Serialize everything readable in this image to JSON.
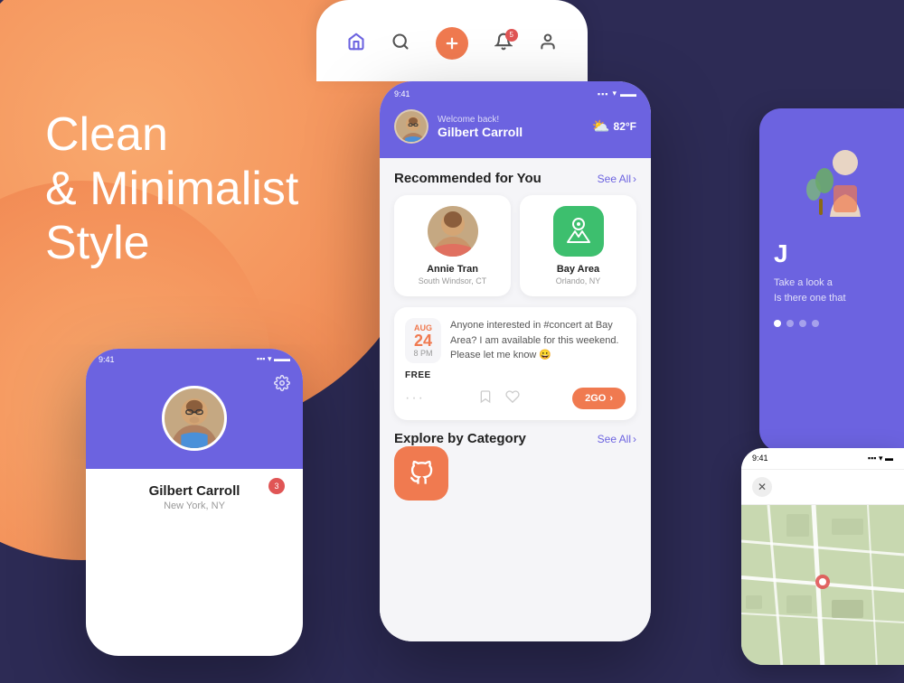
{
  "background": {
    "color": "#2d2b55"
  },
  "hero": {
    "line1": "Clean",
    "line2": "& Minimalist",
    "line3": "Style"
  },
  "phone_profile": {
    "status_time": "9:41",
    "user_name": "Gilbert Carroll",
    "user_location": "New York, NY",
    "badge_count": "3"
  },
  "phone_main": {
    "status_time": "9:41",
    "welcome_sub": "Welcome back!",
    "welcome_name": "Gilbert Carroll",
    "weather_temp": "82°F",
    "recommended_title": "Recommended for You",
    "see_all_1": "See All",
    "person_name": "Annie Tran",
    "person_location": "South Windsor, CT",
    "place_name": "Bay Area",
    "place_location": "Orlando, NY",
    "event_month": "AUG",
    "event_day": "24",
    "event_time": "8 PM",
    "event_desc": "Anyone interested in #concert at Bay Area? I am available for this weekend. Please let me know 😀",
    "event_price": "FREE",
    "event_cta": "2GO",
    "explore_title": "Explore by Category",
    "see_all_2": "See All"
  },
  "phone_top_strip": {
    "nav_home": "🏠",
    "nav_search": "🔍",
    "nav_add": "+",
    "nav_bell": "🔔",
    "nav_user": "👤",
    "badge": "5"
  },
  "right_card": {
    "initial": "J",
    "text1": "Take a look a",
    "text2": "Is there one that",
    "dots": [
      true,
      false,
      false,
      false
    ]
  },
  "map_card": {
    "status_time": "9:41",
    "close_label": "✕"
  }
}
